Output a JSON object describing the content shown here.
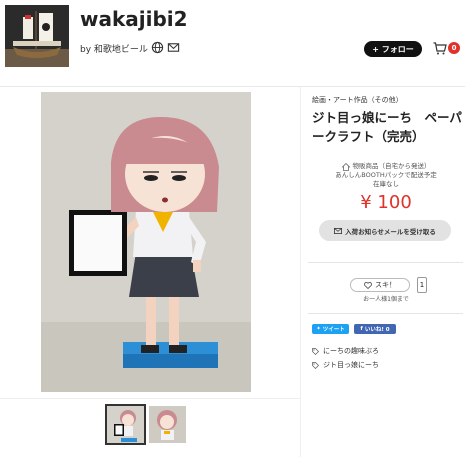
{
  "shop": {
    "name": "wakajibi2",
    "by_prefix": "by",
    "owner": "和歌地ビール"
  },
  "header": {
    "follow_label": "+ フォロー",
    "cart_count": "0"
  },
  "product": {
    "category": "絵画・アート作品（その他）",
    "title": "ジト目っ娘にーち　ペーパークラフト（完売）",
    "ship_type": "物販商品（自宅から発送）",
    "ship_note": "あんしんBOOTHパックで配送予定",
    "stock": "在庫なし",
    "price": "¥ 100",
    "notify_label": "入荷お知らせメールを受け取る"
  },
  "like": {
    "label": "スキ！",
    "count": "1",
    "note": "お一人様1個まで"
  },
  "share": {
    "tweet": "ツイート",
    "facebook": "いいね! 0"
  },
  "tags": [
    {
      "label": "にーちの趣味ぶろ"
    },
    {
      "label": "ジト目っ娘にーち"
    }
  ],
  "colors": {
    "price": "#e0312a",
    "follow_bg": "#111111",
    "twitter": "#1da1f2",
    "facebook": "#4267b2"
  }
}
